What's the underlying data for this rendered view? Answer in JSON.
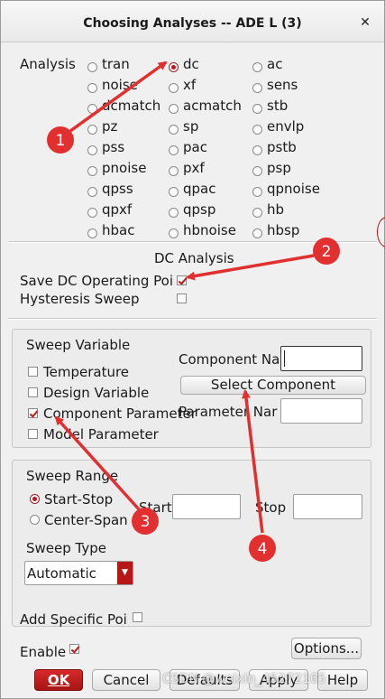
{
  "window": {
    "title": "Choosing Analyses -- ADE L (3)",
    "close_glyph": "✕"
  },
  "analysis": {
    "label": "Analysis",
    "selected": "dc",
    "options": [
      "tran",
      "dc",
      "ac",
      "noise",
      "xf",
      "sens",
      "dcmatch",
      "acmatch",
      "stb",
      "pz",
      "sp",
      "envlp",
      "pss",
      "pac",
      "pstb",
      "pnoise",
      "pxf",
      "psp",
      "qpss",
      "qpac",
      "qpnoise",
      "qpxf",
      "qpsp",
      "hb",
      "hbac",
      "hbnoise",
      "hbsp"
    ]
  },
  "dc_analysis": {
    "heading": "DC Analysis",
    "save_op_label": "Save DC Operating Poi",
    "save_op_checked": true,
    "hysteresis_label": "Hysteresis Sweep",
    "hysteresis_checked": false
  },
  "sweep_variable": {
    "heading": "Sweep Variable",
    "temperature": "Temperature",
    "design_variable": "Design Variable",
    "component_parameter": "Component Parameter",
    "model_parameter": "Model Parameter",
    "checked": "component_parameter",
    "component_name_label": "Component Na",
    "component_name_value": "",
    "select_component": "Select Component",
    "parameter_name_label": "Parameter Nar",
    "parameter_name_value": ""
  },
  "sweep_range": {
    "heading": "Sweep Range",
    "start_stop": "Start-Stop",
    "center_span": "Center-Span",
    "selected": "start_stop",
    "start_label": "Start",
    "start_value": "",
    "stop_label": "Stop",
    "stop_value": "",
    "sweep_type_label": "Sweep Type",
    "sweep_type_value": "Automatic",
    "add_specific_label": "Add Specific Poi",
    "add_specific_checked": false
  },
  "footer": {
    "enable_label": "Enable",
    "enable_checked": true,
    "options_button": "Options...",
    "ok": "OK",
    "cancel": "Cancel",
    "defaults": "Defaults",
    "apply": "Apply",
    "help": "Help"
  },
  "annotations": [
    "1",
    "2",
    "3",
    "4"
  ],
  "watermark": "CSDN @weixin_45272165",
  "colors": {
    "accent": "#c01818",
    "arrow": "#e03030",
    "badge": "#e23030"
  }
}
